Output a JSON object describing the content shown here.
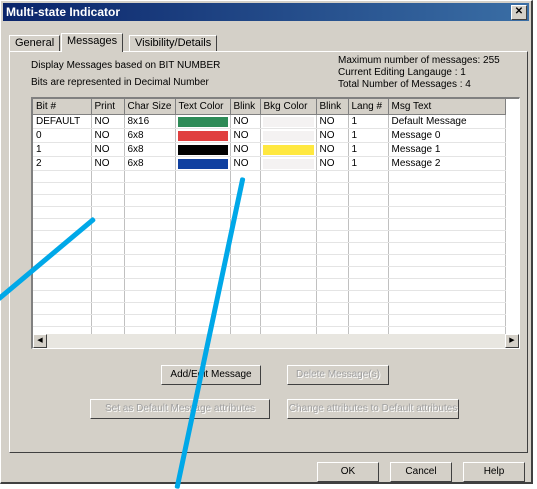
{
  "window": {
    "title": "Multi-state Indicator",
    "close_glyph": "✕"
  },
  "tabs": [
    {
      "label": "General",
      "active": false
    },
    {
      "label": "Messages",
      "active": true
    },
    {
      "label": "Visibility/Details",
      "active": false
    }
  ],
  "info": {
    "display_based": "Display Messages based on BIT NUMBER",
    "bits_decimal": "Bits are represented in Decimal Number",
    "max_messages": "Maximum number of messages: 255",
    "current_language": "Current Editing Langauge :    1",
    "total_messages": "Total  Number of Messages :   4"
  },
  "table": {
    "headers": [
      "Bit #",
      "Print",
      "Char Size",
      "Text Color",
      "Blink",
      "Bkg Color",
      "Blink",
      "Lang #",
      "Msg Text"
    ],
    "rows": [
      {
        "bit": "DEFAULT",
        "print": "NO",
        "char_size": "8x16",
        "text_color": "#2e8b57",
        "blink": "NO",
        "bkg_color": "#f4f2f2",
        "blink2": "NO",
        "lang": "1",
        "msg": "Default Message"
      },
      {
        "bit": "0",
        "print": "NO",
        "char_size": "6x8",
        "text_color": "#e04040",
        "blink": "NO",
        "bkg_color": "#f4f2f2",
        "blink2": "NO",
        "lang": "1",
        "msg": "Message 0"
      },
      {
        "bit": "1",
        "print": "NO",
        "char_size": "6x8",
        "text_color": "#000000",
        "blink": "NO",
        "bkg_color": "#ffe840",
        "blink2": "NO",
        "lang": "1",
        "msg": "Message 1"
      },
      {
        "bit": "2",
        "print": "NO",
        "char_size": "6x8",
        "text_color": "#1040a0",
        "blink": "NO",
        "bkg_color": "#f4f2f2",
        "blink2": "NO",
        "lang": "1",
        "msg": "Message 2"
      }
    ],
    "empty_rows": 15
  },
  "buttons": {
    "add_edit": "Add/Edit Message",
    "delete": "Delete Message(s)",
    "set_default": "Set as Default Message attributes",
    "change_default": "Change attributes to Default attributes",
    "ok": "OK",
    "cancel": "Cancel",
    "help": "Help"
  },
  "colors": {
    "annotation": "#00a8e8",
    "title_bar": "#0a246a",
    "face": "#d4d0c8"
  }
}
